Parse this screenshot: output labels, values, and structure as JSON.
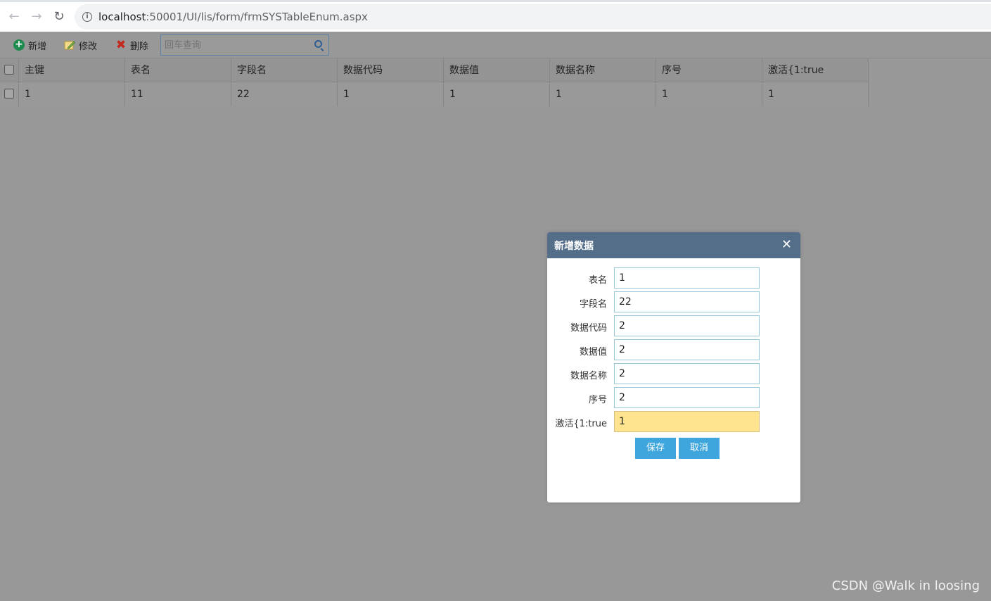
{
  "browser": {
    "url_host": "localhost",
    "url_path": ":50001/UI/lis/form/frmSYSTableEnum.aspx"
  },
  "toolbar": {
    "add_label": "新增",
    "edit_label": "修改",
    "delete_label": "删除",
    "search_placeholder": "回车查询"
  },
  "grid": {
    "columns": [
      "主键",
      "表名",
      "字段名",
      "数据代码",
      "数据值",
      "数据名称",
      "序号",
      "激活{1:true"
    ],
    "rows": [
      [
        "1",
        "11",
        "22",
        "1",
        "1",
        "1",
        "1",
        "1"
      ]
    ]
  },
  "dialog": {
    "title": "新增数据",
    "fields": [
      {
        "label": "表名",
        "value": "1"
      },
      {
        "label": "字段名",
        "value": "22"
      },
      {
        "label": "数据代码",
        "value": "2"
      },
      {
        "label": "数据值",
        "value": "2"
      },
      {
        "label": "数据名称",
        "value": "2"
      },
      {
        "label": "序号",
        "value": "2"
      },
      {
        "label": "激活{1:true",
        "value": "1"
      }
    ],
    "save_label": "保存",
    "cancel_label": "取消"
  },
  "watermark": "CSDN @Walk in loosing"
}
